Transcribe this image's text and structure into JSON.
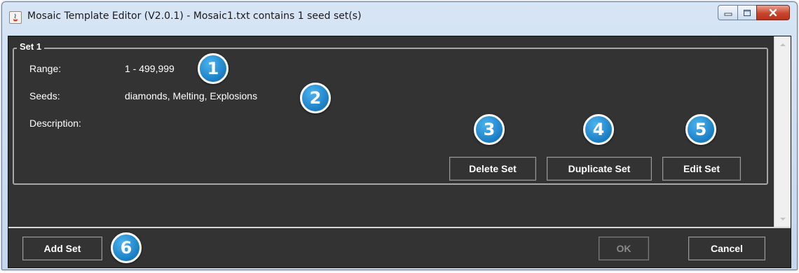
{
  "window": {
    "title": "Mosaic Template Editor (V2.0.1) - Mosaic1.txt contains 1 seed set(s)"
  },
  "set": {
    "legend": "Set 1",
    "range_label": "Range:",
    "range_value": "1 - 499,999",
    "seeds_label": "Seeds:",
    "seeds_value": "diamonds, Melting, Explosions",
    "description_label": "Description:",
    "description_value": ""
  },
  "buttons": {
    "delete_set": "Delete Set",
    "duplicate_set": "Duplicate Set",
    "edit_set": "Edit Set",
    "add_set": "Add Set",
    "ok": "OK",
    "cancel": "Cancel"
  },
  "callouts": [
    "1",
    "2",
    "3",
    "4",
    "5",
    "6"
  ],
  "colors": {
    "content_background": "#333333",
    "callout_blue": "#1a7dc4",
    "close_button_red": "#c9452b"
  },
  "icons": {
    "app": "java-app-icon",
    "minimize": "minimize-icon",
    "maximize": "maximize-icon",
    "close": "close-icon",
    "scroll_up": "scroll-up-arrow-icon",
    "scroll_down": "scroll-down-arrow-icon"
  }
}
